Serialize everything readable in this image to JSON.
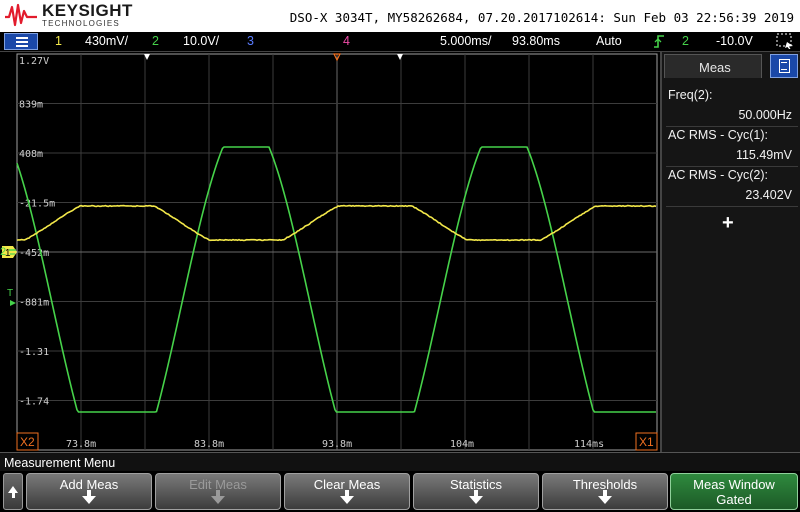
{
  "titlebar": {
    "brand": "KEYSIGHT",
    "brand_sub": "TECHNOLOGIES",
    "device_info": "DSO-X 3034T, MY58262684, 07.20.2017102614: Sun Feb 03 22:56:39 2019"
  },
  "channel_bar": {
    "ch1_num": "1",
    "ch1_scale": "430mV/",
    "ch2_num": "2",
    "ch2_scale": "10.0V/",
    "ch3_num": "3",
    "ch4_num": "4",
    "timebase": "5.000ms/",
    "delay": "93.80ms",
    "trigger_mode": "Auto",
    "trigger_source": "2",
    "trigger_level": "-10.0V"
  },
  "graticule": {
    "v_labels": [
      "1.27V",
      "839m",
      "408m",
      "-21.5m",
      "-452m",
      "-881m",
      "-1.31",
      "-1.74"
    ],
    "t_labels": [
      "73.8m",
      "83.8m",
      "93.8m",
      "104m",
      "114ms"
    ],
    "cursor_x1": "X1",
    "cursor_x2": "X2",
    "ch1_marker": "1",
    "ch2_marker": "2",
    "trig_marker": "T"
  },
  "measurements": {
    "tab_label": "Meas",
    "items": [
      {
        "name": "Freq(2):",
        "value": "50.000Hz"
      },
      {
        "name": "AC RMS - Cyc(1):",
        "value": "115.49mV"
      },
      {
        "name": "AC RMS - Cyc(2):",
        "value": "23.402V"
      }
    ],
    "add_label": "+"
  },
  "softkeys": {
    "menu_title": "Measurement Menu",
    "add_meas": "Add Meas",
    "edit_meas": "Edit Meas",
    "clear_meas": "Clear Meas",
    "statistics": "Statistics",
    "thresholds": "Thresholds",
    "meas_window_l1": "Meas Window",
    "meas_window_l2": "Gated"
  },
  "colors": {
    "ch1": "#f3e84a",
    "ch2": "#46d24a",
    "ch3": "#5a7cff",
    "ch4": "#f04ca8",
    "brand_red": "#e21b2c"
  },
  "chart_data": {
    "type": "line",
    "series": [
      {
        "name": "1",
        "color": "#f3e84a",
        "shape": "clipped-wave",
        "frequency_hz": 50.0,
        "rms_mv": 115.49
      },
      {
        "name": "2",
        "color": "#46d24a",
        "shape": "clipped-sine",
        "frequency_hz": 50.0,
        "rms_v": 23.402
      }
    ],
    "xlim_ms": [
      71.3,
      116.3
    ],
    "grid": true
  }
}
